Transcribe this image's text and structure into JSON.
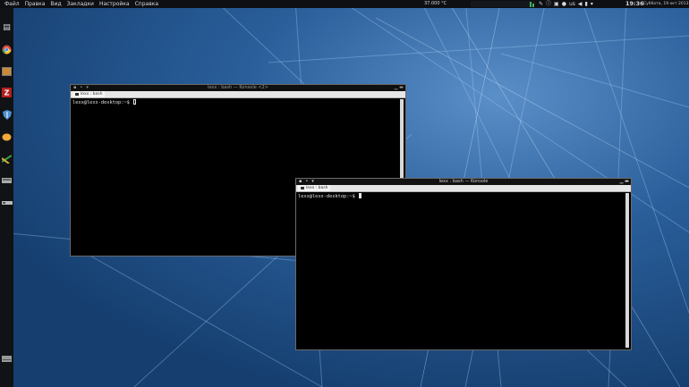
{
  "menu": [
    "Файл",
    "Правка",
    "Вид",
    "Закладки",
    "Настройка",
    "Справка"
  ],
  "panel": {
    "temperature": "37.000 °C",
    "keyboard_layout": "us",
    "time": "19:36",
    "date": "Суббота, 19 окт 2013"
  },
  "dock_icons": [
    "file-manager-icon",
    "chrome-icon",
    "photo-viewer-icon",
    "filezilla-icon",
    "shield-icon",
    "mango-icon",
    "games-icon",
    "drive-icon",
    "network-icon",
    "hard-drive-icon"
  ],
  "windows": [
    {
      "title": "lexx : bash — Konsole <2>",
      "tab_label": "lexx : bash",
      "prompt": "lexx@lexx-desktop:~$ "
    },
    {
      "title": "lexx : bash — Konsole",
      "tab_label": "lexx : bash",
      "prompt": "lexx@lexx-desktop:~$ "
    }
  ],
  "colors": {
    "wallpaper": "#1e4f86",
    "panel": "#0d0f12",
    "terminal_bg": "#000000"
  }
}
